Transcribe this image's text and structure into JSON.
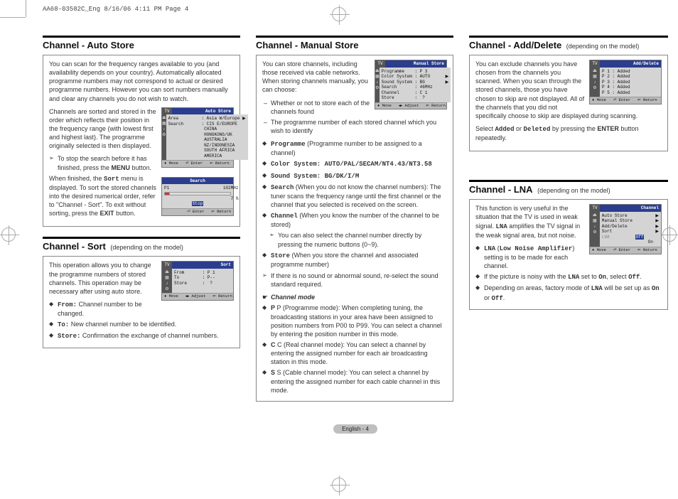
{
  "header_line": "AA68-03582C_Eng  8/16/06  4:11 PM  Page 4",
  "footer": "English - 4",
  "auto_store": {
    "title": "Channel - Auto Store",
    "p1": "You can scan for the frequency ranges available to you (and availability depends on your country). Automatically allocated programme numbers may not correspond to actual or desired programme numbers. However you can sort numbers manually and clear any channels you do not wish to watch.",
    "p2a": "Channels are sorted and stored in the order which reflects their position in the frequency range (with lowest first and highest last). The programme originally selected is then displayed.",
    "arrow1": "To stop the search before it has finished, press the ",
    "arrow1_b": "MENU",
    "arrow1_c": " button.",
    "p3a": "When finished, the ",
    "p3b": "Sort",
    "p3c": " menu is displayed. To sort the stored channels into the desired numerical order, refer to \"Channel - Sort\". To exit without sorting, press the ",
    "p3d": "EXIT",
    "p3e": " button.",
    "osd1": {
      "tv": "TV",
      "title": "Auto Store",
      "rows": [
        "Area         : Asia W/Europe ▶",
        "Search       : CIS E/EUROPE",
        "              CHINA",
        "              HONGKONG/UK",
        "              AUSTRALIA",
        "              NZ/INDONESIA",
        "              SOUTH AFRICA",
        "              AMERICA"
      ],
      "nav": "♦ Move   ⏎ Enter   ⇐ Return"
    },
    "osd2": {
      "title": "Search",
      "row1": "P1                     102MHz",
      "row2": "                          7 %",
      "stop": "Stop",
      "nav": "⏎ Enter   ⇐ Return"
    }
  },
  "sort": {
    "title": "Channel - Sort",
    "sub": "(depending on the model)",
    "p1": "This operation allows you to change the programme numbers of stored channels. This operation may be necessary after using auto store.",
    "li1a": "From:",
    "li1b": " Channel number to be changed.",
    "li2a": "To:",
    "li2b": " New channel number to be identified.",
    "li3a": "Store:",
    "li3b": " Confirmation the exchange of channel numbers.",
    "osd": {
      "tv": "TV",
      "title": "Sort",
      "rows": [
        "From       : P 1",
        "To         : P--",
        "Store      :  ?"
      ],
      "nav": "♦ Move   ◂▸ Adjust   ⇐ Return"
    }
  },
  "manual": {
    "title": "Channel - Manual Store",
    "p1": "You can store channels, including those received via cable networks. When storing channels manually, you can choose:",
    "d1": "Whether or not to store each of the channels found",
    "d2": "The programme number of each stored channel which you wish to identify",
    "li_prog_a": "Programme",
    "li_prog_b": "  (Programme number to be assigned to a channel)",
    "li_color": "Color System: AUTO/PAL/SECAM/NT4.43/NT3.58",
    "li_sound": "Sound System: BG/DK/I/M",
    "li_search_a": "Search",
    "li_search_b": "  (When you do not know the channel numbers): The tuner scans the frequency range until the first channel or the channel that you selected is received on the screen.",
    "li_channel_a": "Channel",
    "li_channel_b": "  (When you know the number of the channel to be stored)",
    "arrow_ch": "You can also select the channel number directly by pressing the numeric buttons (0~9).",
    "li_store_a": "Store",
    "li_store_b": "  (When you store the channel and associated programme number)",
    "arrow_sound": "If there is no sound or abnormal sound, re-select the sound standard required.",
    "cm_head": "Channel mode",
    "cm_p": "P (Programme mode): When completing tuning, the broadcasting stations in your area have been assigned to position numbers from P00 to P99. You can select a channel by entering the position number in this mode.",
    "cm_c": "C (Real channel mode): You can select a channel by entering the assigned number for each air broadcasting station in this mode.",
    "cm_s": "S (Cable channel mode): You can select a channel by entering the assigned number for each cable channel in this mode.",
    "osd": {
      "tv": "TV",
      "title": "Manual Store",
      "rows": [
        "Programme    : P 3",
        "Color System : AUTO      ▶",
        "Sound System : BG        ▶",
        "Search       : 46MHz",
        "Channel      : C 1",
        "Store        :  ?"
      ],
      "nav": "♦ Move   ◂▸ Adjust   ⇐ Return"
    }
  },
  "adddel": {
    "title": "Channel - Add/Delete",
    "sub": "(depending on the model)",
    "p1": "You can exclude channels you have chosen from the channels you scanned. When you scan through the stored channels, those you have chosen to skip are not displayed. All of the channels that you did not specifically choose to skip are displayed during scanning.",
    "p2a": "Select ",
    "p2b": "Added",
    "p2c": " or ",
    "p2d": "Deleted",
    "p2e": " by pressing the ",
    "p2f": "ENTER",
    "p2g": " button repeatedly.",
    "osd": {
      "tv": "TV",
      "title": "Add/Delete",
      "rows": [
        "P 1 : Added",
        "P 2 : Added",
        "P 3 : Added",
        "P 4 : Added",
        "P 5 : Added"
      ],
      "nav": "♦ Move   ⏎ Enter   ⇐ Return"
    }
  },
  "lna": {
    "title": "Channel - LNA",
    "sub": "(depending on the model)",
    "p1a": "This function is very useful in the situation that the TV is used in weak signal. ",
    "p1b": "LNA",
    "p1c": " amplifies the TV signal in the weak signal area, but not noise.",
    "li1a": "LNA",
    "li1b": "Low Noise Amplifier",
    "li1c": " setting is to be made for each channel.",
    "li2a": "If the picture is noisy with the ",
    "li2b": "LNA",
    "li2c": " set to ",
    "li2d": "On",
    "li2e": ", select ",
    "li2f": "Off",
    "li2g": ".",
    "li3a": "Depending on areas, factory mode of ",
    "li3b": "LNA",
    "li3c": " will be set up as ",
    "li3d": "On",
    "li3e": " or ",
    "li3f": "Off",
    "li3g": ".",
    "osd": {
      "tv": "TV",
      "title": "Channel",
      "rows": [
        "Auto Store           ▶",
        "Manual Store         ▶",
        "Add/Delete           ▶",
        "Sort                 ▶"
      ],
      "lna_label": "LNA",
      "off": "Off",
      "on": "On",
      "nav": "♦ Move   ⏎ Enter   ⇐ Return"
    }
  }
}
